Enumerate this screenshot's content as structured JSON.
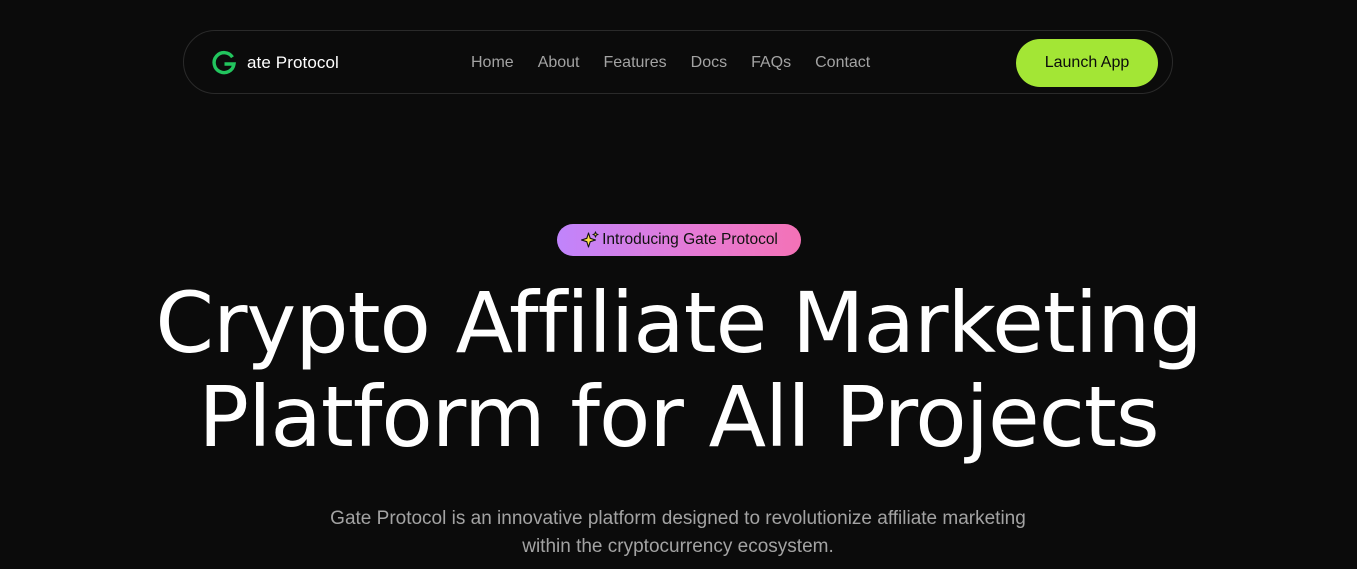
{
  "nav": {
    "brand_name": "ate Protocol",
    "links": [
      "Home",
      "About",
      "Features",
      "Docs",
      "FAQs",
      "Contact"
    ],
    "cta_label": "Launch App"
  },
  "hero": {
    "badge_text": "Introducing Gate Protocol",
    "title_line1": "Crypto Affiliate Marketing",
    "title_line2": "Platform for All Projects",
    "subtitle": "Gate Protocol is an innovative platform designed to revolutionize affiliate marketing within the cryptocurrency ecosystem."
  },
  "colors": {
    "background": "#0b0b0b",
    "accent": "#a3e635",
    "logo_green": "#22c55e",
    "badge_gradient_start": "#c084fc",
    "badge_gradient_end": "#f472b6",
    "muted_text": "#a3a3a3"
  },
  "icons": {
    "logo": "g-logo-icon",
    "badge": "sparkle-icon"
  }
}
